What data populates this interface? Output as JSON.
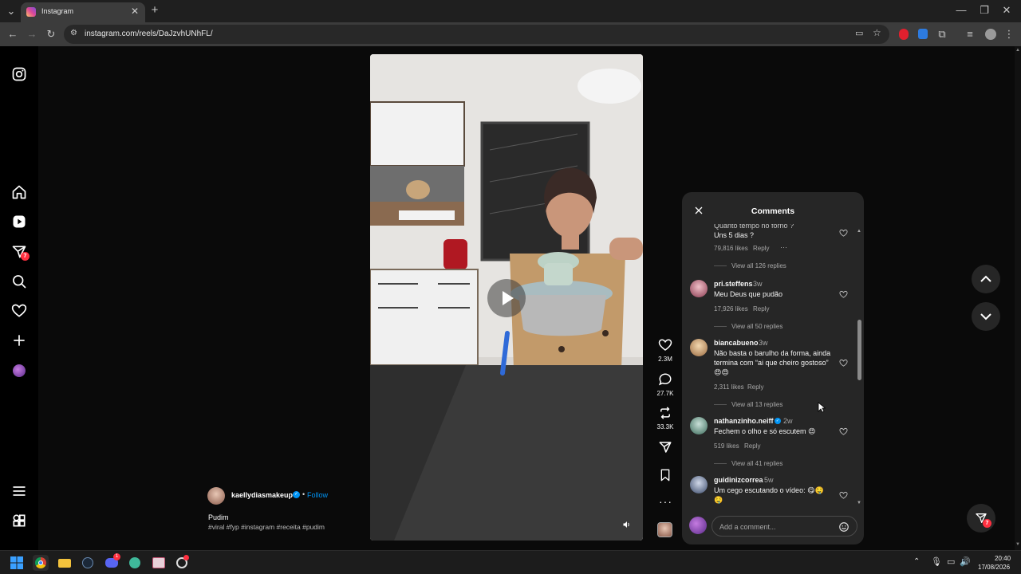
{
  "browser": {
    "tab_title": "Instagram",
    "url": "instagram.com/reels/DaJzvhUNhFL/"
  },
  "reel": {
    "username": "kaellydiasmakeup",
    "follow_label": "Follow",
    "dot": "•",
    "title": "Pudim",
    "hashtags": "#viral #fyp #instagram #receita #pudim",
    "likes": "2.3M",
    "comments": "27.7K",
    "reposts": "33.3K"
  },
  "comments_panel": {
    "title": "Comments",
    "input_placeholder": "Add a comment...",
    "items": [
      {
        "user": "",
        "time": "",
        "text": "Quanto tempo no forno ?",
        "text2": "Uns 5 dias ?",
        "likes": "79,816 likes",
        "reply": "Reply",
        "more": "···",
        "view": "View all 126 replies"
      },
      {
        "user": "pri.steffens",
        "time": "3w",
        "text": "Meu Deus que pudão",
        "likes": "17,926 likes",
        "reply": "Reply",
        "view": "View all 50 replies"
      },
      {
        "user": "biancabueno",
        "time": "3w",
        "text": "Não basta o barulho da forma, ainda",
        "text2": "termina com “ai que cheiro gostoso”",
        "text3": "😍😍",
        "likes": "2,311 likes",
        "reply": "Reply",
        "view": "View all 13 replies"
      },
      {
        "user": "nathanzinho.neiff",
        "time": "2w",
        "text": "Fechem o olho e só escutem 😍",
        "likes": "519 likes",
        "reply": "Reply",
        "view": "View all 41 replies"
      },
      {
        "user": "guidinizcorrea",
        "time": "5w",
        "text": "Um cego escutando o vídeo: 😋🤤",
        "text2": "🤤"
      }
    ]
  },
  "notifications": {
    "left_badge": "7",
    "right_badge": "7"
  },
  "taskbar": {
    "time": "20:40",
    "date": "17/08/2026",
    "discord_badge": "1"
  },
  "colors": {
    "accent_blue": "#0095f6",
    "badge_red": "#ff3040",
    "panel_bg": "#262626"
  }
}
